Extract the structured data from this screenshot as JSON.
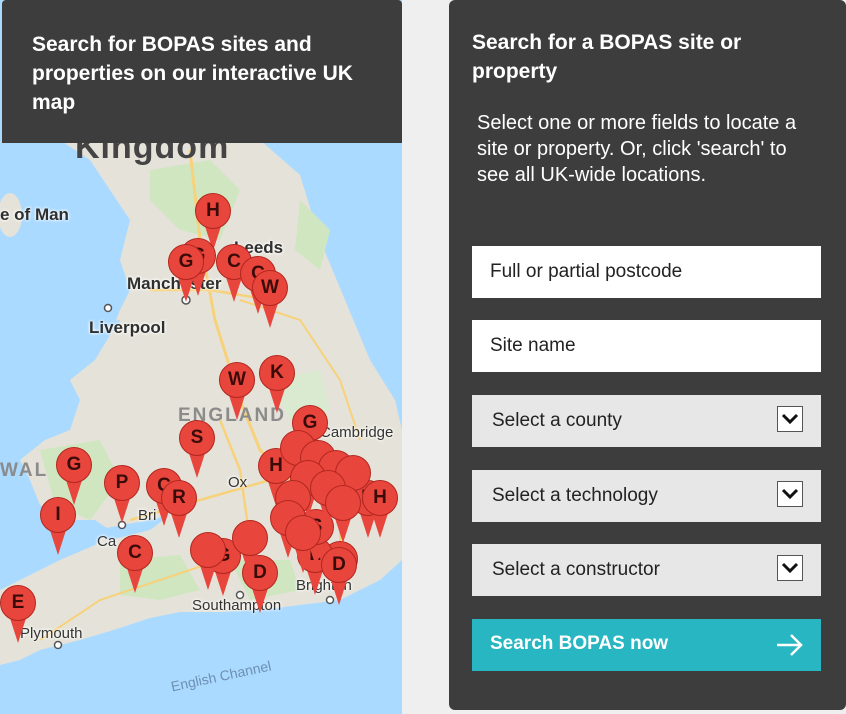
{
  "map_panel": {
    "header_title": "Search for BOPAS sites and properties on our interactive UK map",
    "labels": {
      "kingdom": "Kingdom",
      "isle_of_man": "e of Man",
      "manchester": "Manchester",
      "leeds": "Leeds",
      "liverpool": "Liverpool",
      "england": "ENGLAND",
      "cambridge": "Cambridge",
      "wales": "WAL",
      "oxford": "Ox",
      "bristol": "Bri",
      "cardiff": "Ca",
      "southampton": "Southampton",
      "brighton": "Brighton",
      "plymouth": "Plymouth",
      "channel": "English Channel"
    },
    "markers": [
      "H",
      "G",
      "G",
      "C",
      "C",
      "W",
      "W",
      "K",
      "G",
      "S",
      "G",
      "P",
      "C",
      "R",
      "I",
      "C",
      "G",
      "D",
      "D",
      "L",
      "D",
      "H",
      "H",
      "H",
      "S",
      "E"
    ]
  },
  "search_panel": {
    "title": "Search for a BOPAS site or property",
    "intro": "Select one or more fields to locate a site or property. Or, click 'search' to see all UK-wide locations.",
    "postcode_placeholder": "Full or partial postcode",
    "site_name_placeholder": "Site name",
    "county_select": "Select a county",
    "technology_select": "Select a technology",
    "constructor_select": "Select a constructor",
    "search_button": "Search BOPAS now"
  },
  "colors": {
    "panel_bg": "#3d3d3d",
    "accent": "#27b6c2",
    "marker": "#e8453c"
  }
}
